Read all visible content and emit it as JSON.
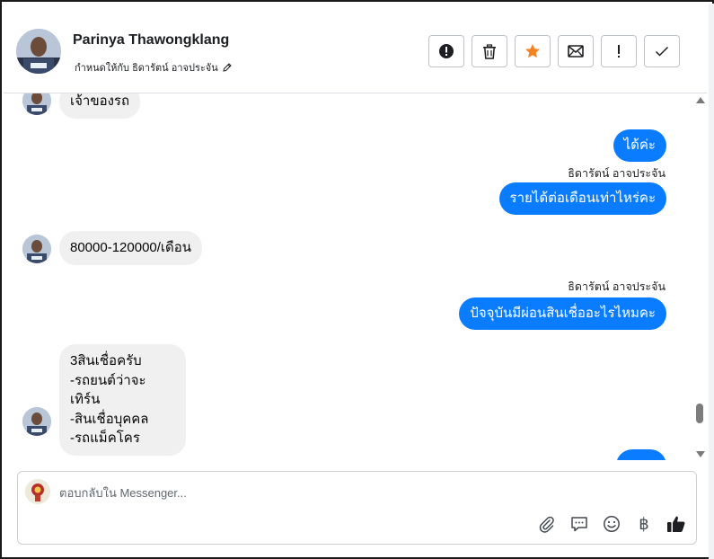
{
  "header": {
    "contact_name": "Parinya Thawongklang",
    "assigned_text": "กำหนดให้กับ ธิดารัตน์ อาจประจัน",
    "actions": [
      {
        "name": "report-button",
        "icon": "alert-circle-icon"
      },
      {
        "name": "delete-button",
        "icon": "trash-icon"
      },
      {
        "name": "star-button",
        "icon": "star-icon",
        "color": "#f5821f"
      },
      {
        "name": "mark-unread-button",
        "icon": "envelope-icon"
      },
      {
        "name": "spam-button",
        "icon": "exclamation-icon"
      },
      {
        "name": "done-button",
        "icon": "checkmark-icon"
      }
    ]
  },
  "messages": {
    "m1": "เจ้าของรถ",
    "m2": "ได้ค่ะ",
    "m3_sender": "ธิดารัตน์ อาจประจัน",
    "m3": "รายได้ต่อเดือนเท่าไหร่คะ",
    "m4": "80000-120000/เดือน",
    "m5_sender": "ธิดารัตน์ อาจประจัน",
    "m5": "ปัจจุบันมีผ่อนสินเชื่ออะไรไหมคะ",
    "m6": "3สินเชื่อครับ\n-รถยนต์ว่าจะเทิร์น\n-สินเชื่อบุคคล\n-รถแม็คโคร"
  },
  "composer": {
    "placeholder": "ตอบกลับใน Messenger..."
  },
  "colors": {
    "outgoing": "#0a7cff",
    "incoming": "#f0f0f0",
    "star": "#f5821f"
  }
}
